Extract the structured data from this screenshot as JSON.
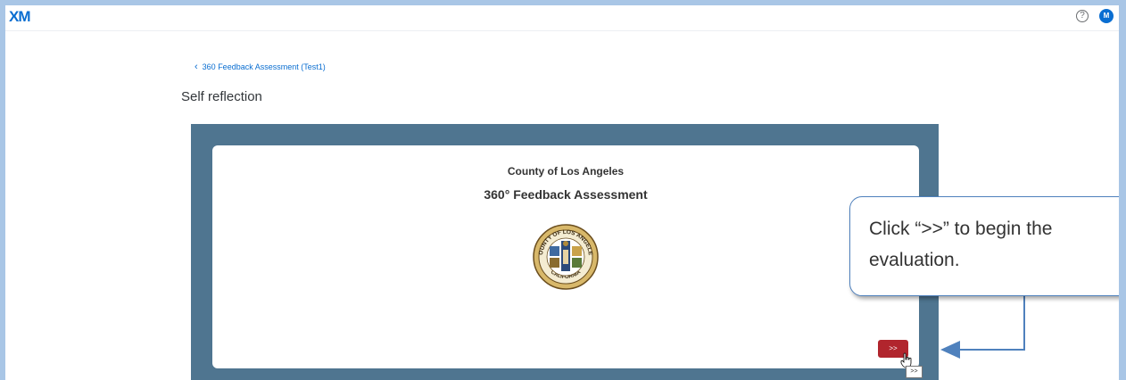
{
  "app": {
    "logo": "XM"
  },
  "header": {
    "help_glyph": "?",
    "avatar_initial": "M"
  },
  "breadcrumb": {
    "label": "360 Feedback Assessment (Test1)"
  },
  "page": {
    "title": "Self reflection"
  },
  "survey": {
    "org_name": "County of Los Angeles",
    "title": "360° Feedback Assessment",
    "seal_top_text": "COUNTY OF LOS ANGELES",
    "seal_bottom_text": "CALIFORNIA",
    "next_button_label": ">>",
    "tooltip_text": ">>"
  },
  "callout": {
    "text": "Click “>>” to begin the evaluation."
  },
  "colors": {
    "accent": "#0a6ed1",
    "survey_background": "#4f7590",
    "next_button": "#b1252d",
    "callout_border": "#4f81bd",
    "arrow": "#4f81bd"
  }
}
